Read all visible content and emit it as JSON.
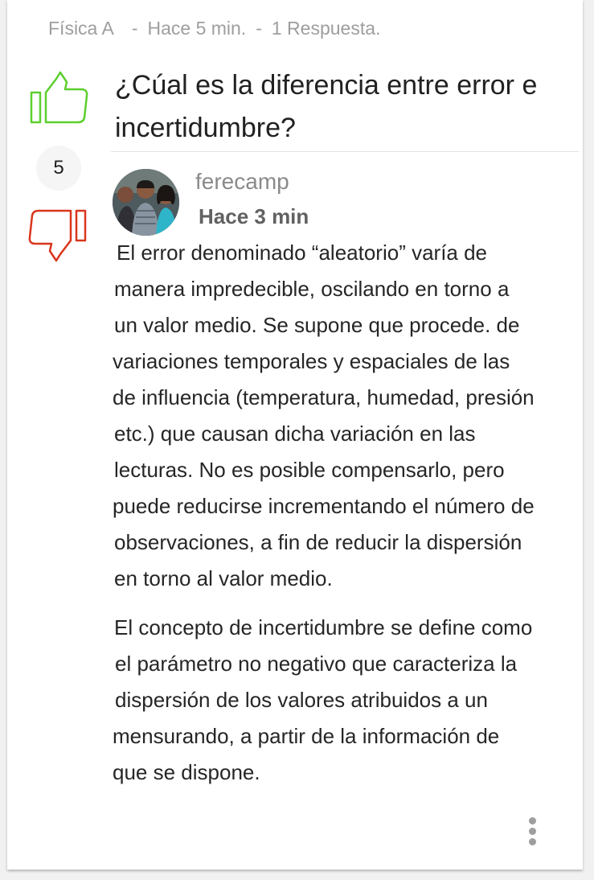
{
  "question": {
    "subject": "Física A",
    "posted": "Hace 5 min.",
    "answers_count": "1 Respuesta.",
    "separator": "-",
    "title": "¿Cúal es la diferencia entre error e incertidumbre?",
    "votes": "5"
  },
  "answer": {
    "username": "ferecamp",
    "time": "Hace 3 min",
    "paragraph1_lines": [
      "El error denominado “aleatorio” varía de",
      "manera impredecible, oscilando en torno a",
      "un valor medio. Se supone que procede. de",
      "variaciones temporales y espaciales de las",
      "de influencia (temperatura, humedad, presión",
      "etc.) que causan dicha variación en las",
      "lecturas. No es posible compensarlo, pero",
      "puede reducirse incrementando el número de",
      "observaciones, a fin de reducir la dispersión",
      "en torno al valor medio."
    ],
    "paragraph2_lines": [
      "El concepto de incertidumbre  se define como",
      "el parámetro no negativo que caracteriza la",
      "dispersión de los valores atribuidos a un",
      "mensurando, a partir de la información de",
      "que se dispone."
    ]
  },
  "icons": {
    "upvote": "thumbs-up-icon",
    "downvote": "thumbs-down-icon",
    "more": "more-vertical-icon"
  },
  "colors": {
    "upvote": "#5ccf2e",
    "downvote": "#d9361c",
    "meta": "#9e9e9e"
  }
}
